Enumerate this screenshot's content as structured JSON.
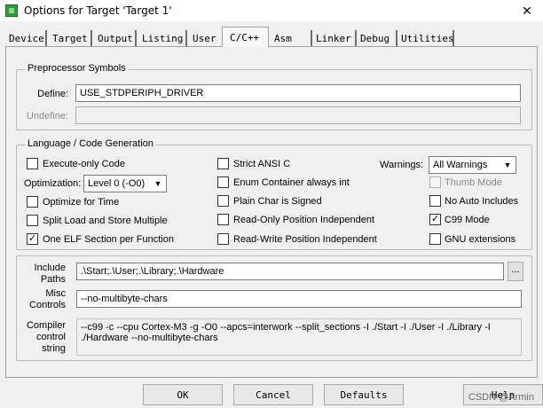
{
  "window": {
    "title": "Options for Target 'Target 1'",
    "close_glyph": "✕"
  },
  "tabs": [
    {
      "label": "Device"
    },
    {
      "label": "Target"
    },
    {
      "label": "Output"
    },
    {
      "label": "Listing"
    },
    {
      "label": "User"
    },
    {
      "label": "C/C++"
    },
    {
      "label": "Asm"
    },
    {
      "label": "Linker"
    },
    {
      "label": "Debug"
    },
    {
      "label": "Utilities"
    }
  ],
  "active_tab": "C/C++",
  "preprocessor": {
    "title": "Preprocessor Symbols",
    "define_label": "Define:",
    "define_value": "USE_STDPERIPH_DRIVER",
    "undefine_label": "Undefine:",
    "undefine_value": ""
  },
  "codegen": {
    "title": "Language / Code Generation",
    "execute_only": {
      "label": "Execute-only Code",
      "checked": false
    },
    "optimization_label": "Optimization:",
    "optimization_value": "Level 0 (-O0)",
    "optimize_time": {
      "label": "Optimize for Time",
      "checked": false
    },
    "split_load": {
      "label": "Split Load and Store Multiple",
      "checked": false
    },
    "one_elf": {
      "label": "One ELF Section per Function",
      "checked": true
    },
    "strict_ansi": {
      "label": "Strict ANSI C",
      "checked": false
    },
    "enum_container": {
      "label": "Enum Container always int",
      "checked": false
    },
    "plain_char": {
      "label": "Plain Char is Signed",
      "checked": false
    },
    "ro_pi": {
      "label": "Read-Only Position Independent",
      "checked": false
    },
    "rw_pi": {
      "label": "Read-Write Position Independent",
      "checked": false
    },
    "warnings_label": "Warnings:",
    "warnings_value": "All Warnings",
    "thumb_mode": {
      "label": "Thumb Mode",
      "checked": false,
      "disabled": true
    },
    "no_auto_includes": {
      "label": "No Auto Includes",
      "checked": false
    },
    "c99_mode": {
      "label": "C99 Mode",
      "checked": true
    },
    "gnu_ext": {
      "label": "GNU extensions",
      "checked": false
    }
  },
  "paths": {
    "include_label_1": "Include",
    "include_label_2": "Paths",
    "include_value": ".\\Start;.\\User;.\\Library;.\\Hardware",
    "browse_label": "...",
    "misc_label_1": "Misc",
    "misc_label_2": "Controls",
    "misc_value": "--no-multibyte-chars",
    "compiler_label_1": "Compiler",
    "compiler_label_2": "control",
    "compiler_label_3": "string",
    "compiler_value": "--c99 -c --cpu Cortex-M3 -g -O0 --apcs=interwork --split_sections -I ./Start -I ./User -I ./Library -I ./Hardware --no-multibyte-chars"
  },
  "buttons": {
    "ok": "OK",
    "cancel": "Cancel",
    "defaults": "Defaults",
    "help": "Help"
  },
  "watermark": "CSDN @Armin",
  "check_glyph": "✓",
  "icons": {
    "app": "keil-app-icon",
    "dropdown": "chevron-down-icon"
  }
}
